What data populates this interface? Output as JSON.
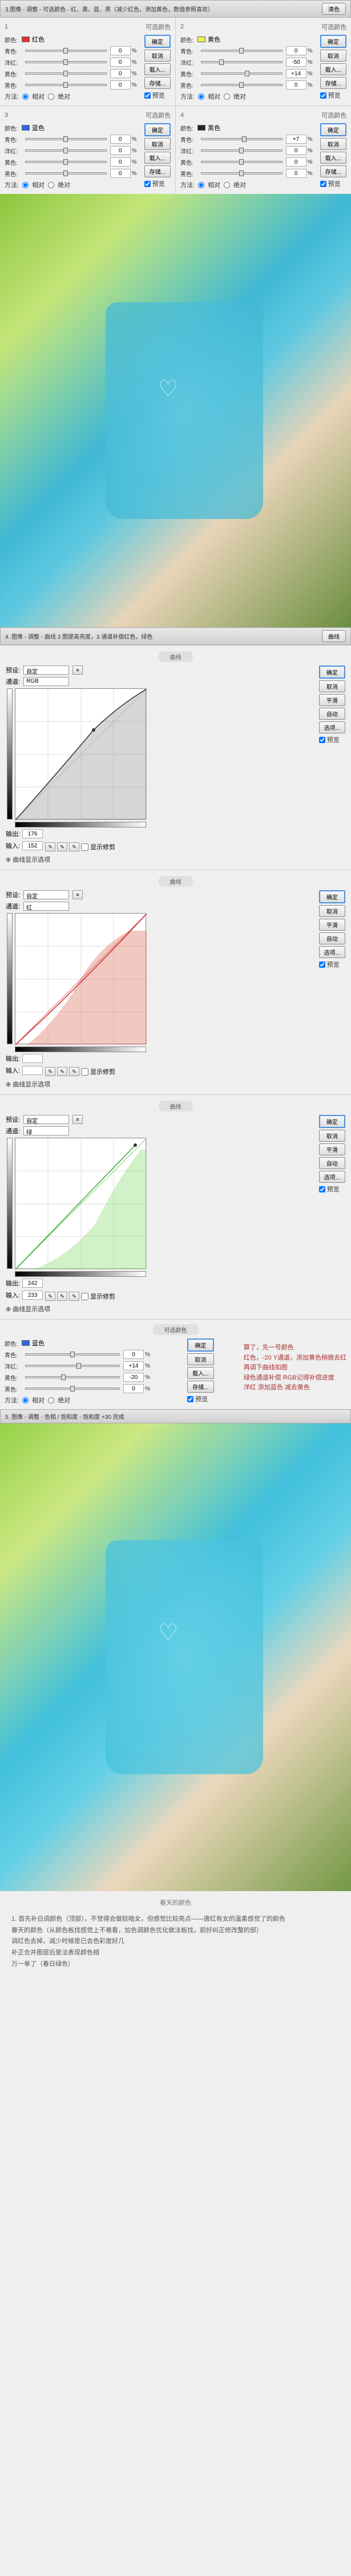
{
  "step3": {
    "header": "3.图像 - 调整 - 可选颜色 - 红、黄、蓝、黑（减少红色，添加黄色，数值参照喜欢）",
    "btn": "清色",
    "panelTitle": "可选颜色",
    "panels": [
      {
        "num": "1",
        "color": "#d33",
        "colorName": "红色",
        "c": "0",
        "m": "0",
        "y": "0",
        "k": "0"
      },
      {
        "num": "2",
        "color": "#ee5",
        "colorName": "黄色",
        "c": "0",
        "m": "-50",
        "y": "+14",
        "k": "0"
      },
      {
        "num": "3",
        "color": "#36d",
        "colorName": "蓝色",
        "c": "0",
        "m": "0",
        "y": "0",
        "k": "0"
      },
      {
        "num": "4",
        "color": "#222",
        "colorName": "黑色",
        "c": "+7",
        "m": "0",
        "y": "0",
        "k": "0"
      }
    ],
    "labels": {
      "color": "颜色:",
      "c": "青色:",
      "m": "洋红:",
      "y": "黄色:",
      "k": "黑色:",
      "method": "方法:",
      "rel": "相对",
      "abs": "绝对"
    },
    "buttons": {
      "ok": "确定",
      "cancel": "取消",
      "load": "载入...",
      "save": "存储...",
      "preview": "预览"
    }
  },
  "step4": {
    "header": "4. 图像 - 调整 - 曲线 3 图提高亮度，3 通道补偿红色，绿色",
    "btn": "曲线",
    "title": "曲线",
    "preset": "预设:",
    "presetVal": "自定",
    "channel": "通道:",
    "channels": [
      "RGB",
      "红",
      "绿"
    ],
    "output": "输出:",
    "input": "输入:",
    "curves": [
      {
        "ch": "RGB",
        "out": "176",
        "in": "152",
        "fill": "rgba(120,120,120,0.3)"
      },
      {
        "ch": "红",
        "out": "",
        "in": "",
        "fill": "rgba(220,120,100,0.4)"
      },
      {
        "ch": "绿",
        "out": "242",
        "in": "233",
        "fill": "rgba(140,220,120,0.4)"
      }
    ],
    "buttons": {
      "ok": "确定",
      "cancel": "取消",
      "smooth": "平滑",
      "auto": "自动",
      "options": "选项...",
      "preview": "预览"
    },
    "curveOpts": "曲线显示选项",
    "showClip": "显示修剪"
  },
  "step4b": {
    "title": "可选颜色",
    "color": "#36d",
    "colorName": "蓝色",
    "c": "0",
    "m": "+14",
    "y": "-20",
    "k": "0",
    "notes": [
      "算了，先一号颜色",
      "红色，-20 Y通道，添加黄色稍微去红",
      "再调下曲线如图",
      "绿色通道补偿 RGB记得补偿进度",
      "洋红 添加蓝色 减去黄色"
    ]
  },
  "step5": {
    "header": "5. 图像 - 调整 - 色相 / 饱和度 - 饱和度 +30      完成",
    "btn": ""
  },
  "footer": {
    "title": "春天的颜色",
    "lines": [
      "1. 首先补白调颜色（顶部），不觉得会做较暗女，但感觉比较亮点——唐红有女的温柔感觉了的颜色",
      "春天的颜色（从颜色板找感觉上不难看，加色调颜色优化做法板找，前好纠正修改整的部）",
      "调红色去掉，减少时候是已会色彩度好几",
      "补正合并图层后是法表现颜色相",
      "万一单了（春日绿色）"
    ]
  }
}
